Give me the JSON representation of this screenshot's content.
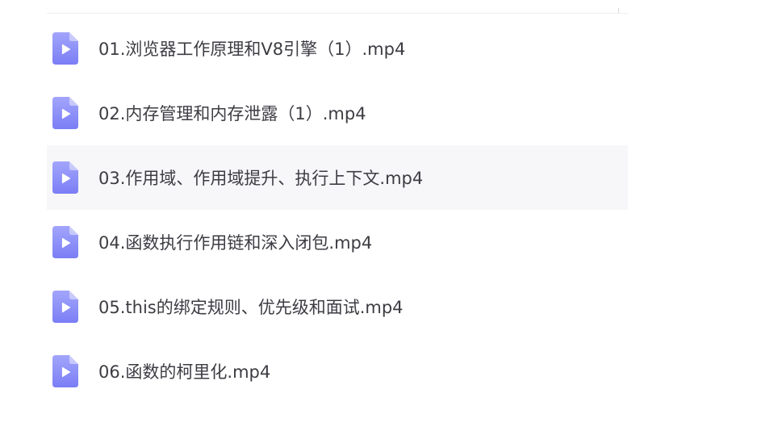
{
  "colors": {
    "icon_fill": "#7b7ef5",
    "icon_fill_light": "#a3a5fb",
    "text": "#3c3c43",
    "hover_row": "#f7f7f9"
  },
  "icons": {
    "file": "video-file-icon"
  },
  "files": [
    {
      "name": "01.浏览器工作原理和V8引擎（1）.mp4"
    },
    {
      "name": "02.内存管理和内存泄露（1）.mp4"
    },
    {
      "name": "03.作用域、作用域提升、执行上下文.mp4"
    },
    {
      "name": "04.函数执行作用链和深入闭包.mp4"
    },
    {
      "name": "05.this的绑定规则、优先级和面试.mp4"
    },
    {
      "name": "06.函数的柯里化.mp4"
    }
  ]
}
